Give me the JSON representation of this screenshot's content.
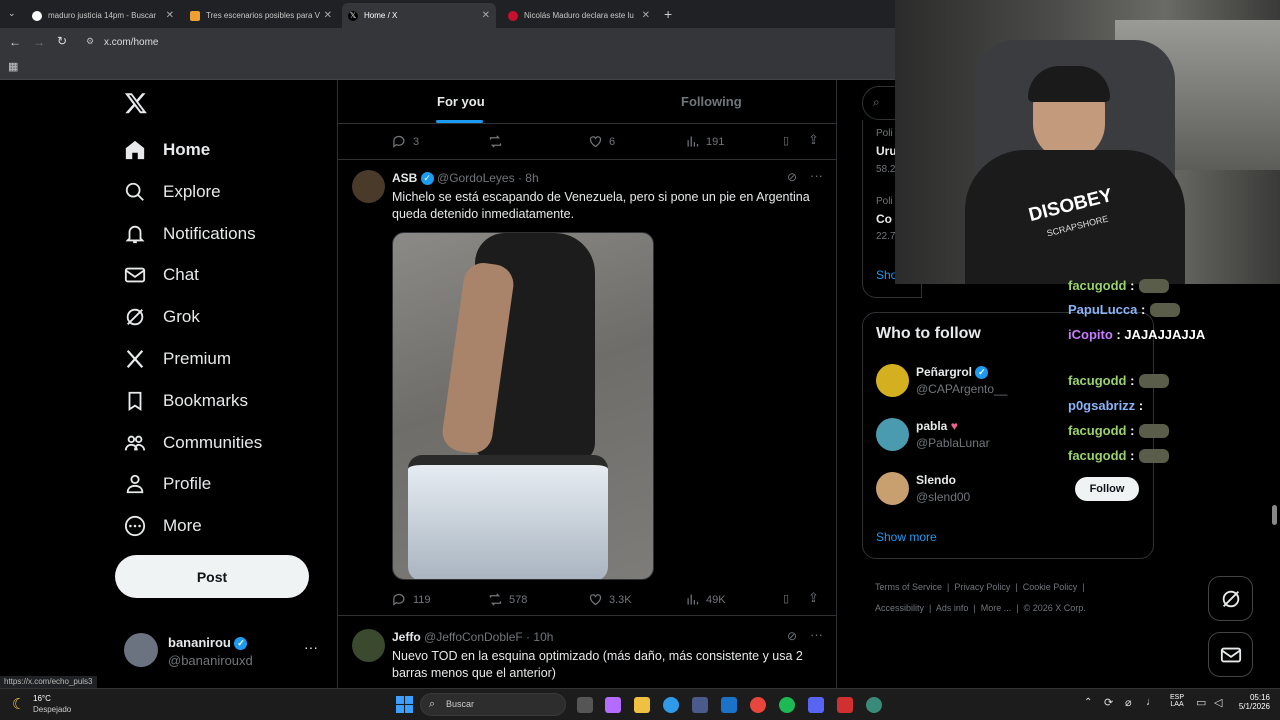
{
  "browser": {
    "tabs": [
      {
        "title": "maduro justicia 14pm - Buscar"
      },
      {
        "title": "Tres escenarios posibles para V"
      },
      {
        "title": "Home / X"
      },
      {
        "title": "Nicolás Maduro declara este lu"
      }
    ],
    "url": "x.com/home",
    "status_url": "https://x.com/echo_puls3"
  },
  "nav": {
    "items": [
      {
        "label": "Home",
        "icon": "home-icon"
      },
      {
        "label": "Explore",
        "icon": "search-icon"
      },
      {
        "label": "Notifications",
        "icon": "bell-icon"
      },
      {
        "label": "Chat",
        "icon": "mail-icon"
      },
      {
        "label": "Grok",
        "icon": "grok-icon"
      },
      {
        "label": "Premium",
        "icon": "x-icon"
      },
      {
        "label": "Bookmarks",
        "icon": "bookmark-icon"
      },
      {
        "label": "Communities",
        "icon": "people-icon"
      },
      {
        "label": "Profile",
        "icon": "person-icon"
      },
      {
        "label": "More",
        "icon": "more-circle-icon"
      }
    ],
    "post_label": "Post",
    "account": {
      "name": "bananirou",
      "handle": "@bananirouxd"
    }
  },
  "feed": {
    "tabs": [
      "For you",
      "Following"
    ],
    "prev_metrics": {
      "replies": "3",
      "likes": "6",
      "views": "191"
    },
    "posts": [
      {
        "name": "ASB",
        "handle": "@GordoLeyes",
        "time": "8h",
        "text": "Michelo se está escapando de Venezuela, pero si pone un pie en Argentina queda detenido inmediatamente.",
        "metrics": {
          "replies": "119",
          "reposts": "578",
          "likes": "3.3K",
          "views": "49K"
        }
      },
      {
        "name": "Jeffo",
        "handle": "@JeffoConDobleF",
        "time": "10h",
        "text": "Nuevo TOD en la esquina optimizado (más daño, más consistente y usa 2 barras menos que el anterior)"
      }
    ]
  },
  "sidebar": {
    "trend_snippets": [
      "Poli",
      "Uru",
      "58.2",
      "Poli",
      "Co",
      "22.7",
      "Sho"
    ],
    "who_to_follow": {
      "title": "Who to follow",
      "accounts": [
        {
          "name": "Peñargrol",
          "handle": "@CAPArgento__"
        },
        {
          "name": "pabla",
          "handle": "@PablaLunar"
        },
        {
          "name": "Slendo",
          "handle": "@slend00"
        }
      ],
      "follow_label": "Follow",
      "show_more": "Show more"
    },
    "footer": [
      "Terms of Service",
      "Privacy Policy",
      "Cookie Policy",
      "Accessibility",
      "Ads info",
      "More ...",
      "© 2026 X Corp."
    ]
  },
  "stream_chat": [
    {
      "user": "facugodd",
      "msg": "",
      "color": "#9ad36a"
    },
    {
      "user": "PapuLucca",
      "msg": "",
      "color": "#8ab4f8"
    },
    {
      "user": "iCopito",
      "msg": "JAJAJJAJJA",
      "color": "#c77dff"
    },
    {
      "user": "facugodd",
      "msg": "",
      "color": "#9ad36a"
    },
    {
      "user": "p0gsabrizz",
      "msg": "",
      "color": "#8ab4f8"
    },
    {
      "user": "facugodd",
      "msg": "",
      "color": "#9ad36a"
    },
    {
      "user": "facugodd",
      "msg": "",
      "color": "#9ad36a"
    }
  ],
  "webcam": {
    "shirt_text": "DISOBEY",
    "shirt_sub": "SCRAPSHORE"
  },
  "taskbar": {
    "weather_temp": "16°C",
    "weather_desc": "Despejado",
    "search_placeholder": "Buscar",
    "lang": "ESP",
    "lang_sub": "LAA",
    "time": "05:16",
    "date": "5/1/2026"
  }
}
